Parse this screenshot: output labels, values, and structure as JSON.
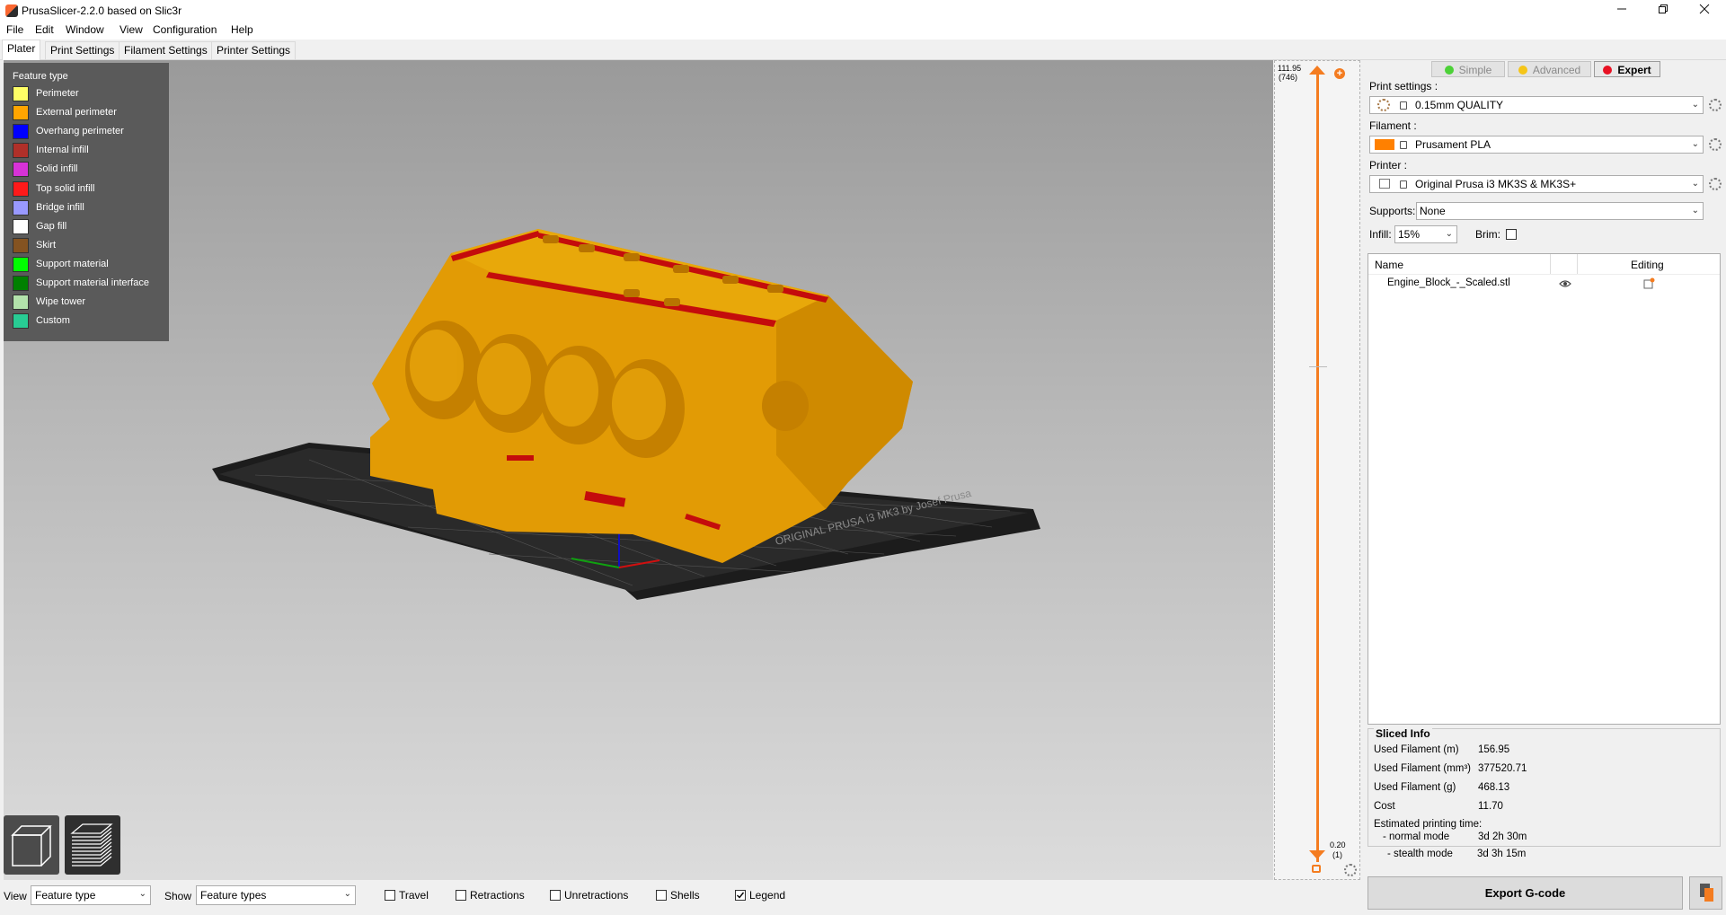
{
  "window": {
    "title": "PrusaSlicer-2.2.0 based on Slic3r",
    "minimize_icon": "minimize-icon",
    "maximize_icon": "restore-icon",
    "close_icon": "close-icon"
  },
  "menu": [
    "File",
    "Edit",
    "Window",
    "View",
    "Configuration",
    "Help"
  ],
  "tabs": [
    "Plater",
    "Print Settings",
    "Filament Settings",
    "Printer Settings"
  ],
  "active_tab": "Plater",
  "legend": {
    "title": "Feature type",
    "items": [
      {
        "label": "Perimeter",
        "color": "#ffff66"
      },
      {
        "label": "External perimeter",
        "color": "#ffa500"
      },
      {
        "label": "Overhang perimeter",
        "color": "#0000ff"
      },
      {
        "label": "Internal infill",
        "color": "#b03029"
      },
      {
        "label": "Solid infill",
        "color": "#d732d7"
      },
      {
        "label": "Top solid infill",
        "color": "#ff1a1a"
      },
      {
        "label": "Bridge infill",
        "color": "#9999ff"
      },
      {
        "label": "Gap fill",
        "color": "#ffffff"
      },
      {
        "label": "Skirt",
        "color": "#845321"
      },
      {
        "label": "Support material",
        "color": "#00ff00"
      },
      {
        "label": "Support material interface",
        "color": "#008000"
      },
      {
        "label": "Wipe tower",
        "color": "#b3e3ab"
      },
      {
        "label": "Custom",
        "color": "#28cc94"
      }
    ]
  },
  "layer_slider": {
    "top_value": "111.95",
    "top_layer": "(746)",
    "bottom_value": "0.20",
    "bottom_layer": "(1)",
    "add_icon": "plus-circle-icon",
    "lock_icon": "unlock-icon",
    "settings_icon": "cog-icon"
  },
  "mode": {
    "simple": "Simple",
    "advanced": "Advanced",
    "expert": "Expert",
    "active": "Expert",
    "colors": {
      "simple": "#4cd137",
      "advanced": "#f5c518",
      "expert": "#e81123"
    }
  },
  "settings": {
    "print_label": "Print settings :",
    "print_value": "0.15mm QUALITY",
    "filament_label": "Filament :",
    "filament_value": "Prusament PLA",
    "filament_color": "#ff8000",
    "printer_label": "Printer :",
    "printer_value": "Original Prusa i3 MK3S & MK3S+",
    "supports_label": "Supports:",
    "supports_value": "None",
    "infill_label": "Infill:",
    "infill_value": "15%",
    "brim_label": "Brim:",
    "brim_checked": false
  },
  "object_list": {
    "col_name": "Name",
    "col_editing": "Editing",
    "rows": [
      {
        "name": "Engine_Block_-_Scaled.stl",
        "visible_icon": "eye-icon",
        "edit_icon": "edit-icon"
      }
    ]
  },
  "sliced_info": {
    "title": "Sliced Info",
    "rows": [
      {
        "label": "Used Filament (m)",
        "value": "156.95"
      },
      {
        "label": "Used Filament (mm³)",
        "value": "377520.71"
      },
      {
        "label": "Used Filament (g)",
        "value": "468.13"
      },
      {
        "label": "Cost",
        "value": "11.70"
      }
    ],
    "time_label": "Estimated printing time:",
    "normal_label": "- normal mode",
    "normal_value": "3d 2h 30m",
    "stealth_label": "- stealth mode",
    "stealth_value": "3d 3h 15m"
  },
  "export_button": "Export G-code",
  "bottom_bar": {
    "view_label": "View",
    "view_value": "Feature type",
    "show_label": "Show",
    "show_value": "Feature types",
    "checkboxes": [
      {
        "label": "Travel",
        "checked": false
      },
      {
        "label": "Retractions",
        "checked": false
      },
      {
        "label": "Unretractions",
        "checked": false
      },
      {
        "label": "Shells",
        "checked": false
      },
      {
        "label": "Legend",
        "checked": true
      }
    ]
  },
  "bed_text": "ORIGINAL PRUSA i3 MK3 by Josef Prusa"
}
